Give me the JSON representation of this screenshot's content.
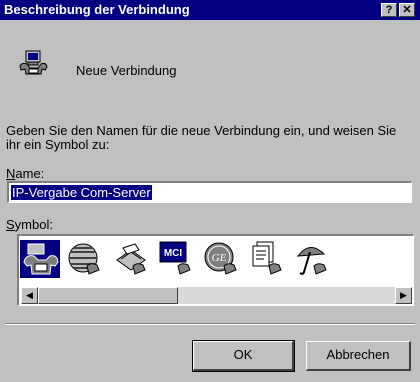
{
  "window": {
    "title": "Beschreibung der Verbindung",
    "help_button": "?",
    "close_button": "✕"
  },
  "connection": {
    "icon": "connection-phone-computer-icon",
    "label": "Neue Verbindung"
  },
  "prompt": "Geben Sie den Namen für die neue Verbindung ein, und weisen Sie ihr ein Symbol zu:",
  "name_field": {
    "label": "Name:",
    "value": "IP-Vergabe Com-Server"
  },
  "symbol_field": {
    "label": "Symbol:",
    "icons": [
      "phone-icon",
      "globe-icon",
      "fax-icon",
      "mci-icon",
      "ge-icon",
      "documents-phone-icon",
      "umbrella-icon"
    ],
    "mci_text": "MCI",
    "ge_text": "GE"
  },
  "scroll": {
    "left_arrow": "◀",
    "right_arrow": "▶"
  },
  "buttons": {
    "ok": "OK",
    "cancel": "Abbrechen"
  },
  "colors": {
    "titlebar": "#000080",
    "face": "#c0c0c0",
    "selection": "#000080"
  }
}
